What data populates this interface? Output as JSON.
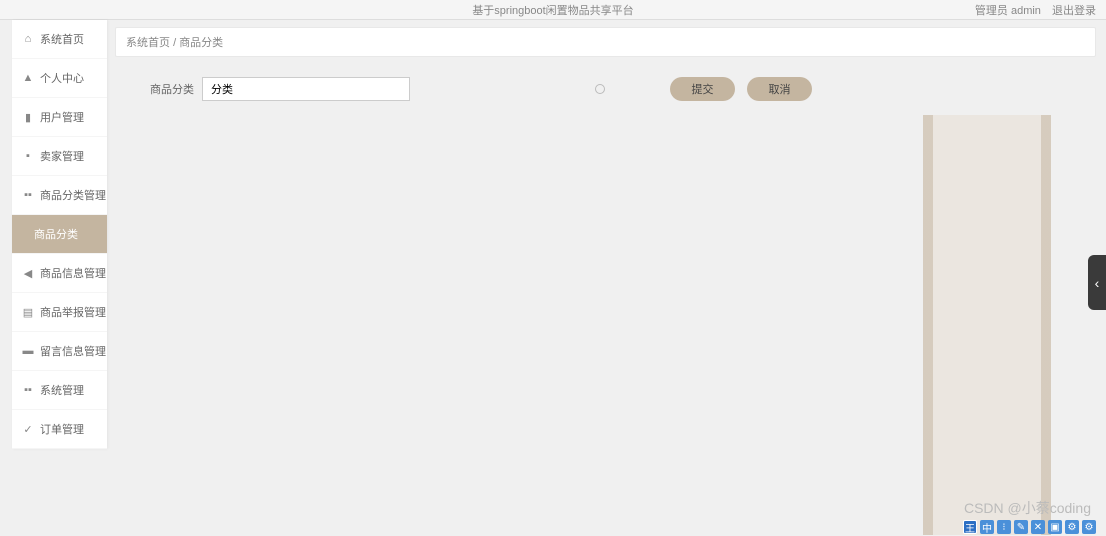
{
  "header": {
    "title": "基于springboot闲置物品共享平台",
    "admin_label": "管理员 admin",
    "logout_label": "退出登录"
  },
  "sidebar": {
    "items": [
      {
        "icon": "⌂",
        "label": "系统首页"
      },
      {
        "icon": "▲",
        "label": "个人中心"
      },
      {
        "icon": "▮",
        "label": "用户管理"
      },
      {
        "icon": "▪",
        "label": "卖家管理"
      },
      {
        "icon": "▪▪",
        "label": "商品分类管理"
      },
      {
        "icon": "",
        "label": "商品分类"
      },
      {
        "icon": "◀",
        "label": "商品信息管理"
      },
      {
        "icon": "▤",
        "label": "商品举报管理"
      },
      {
        "icon": "▬",
        "label": "留言信息管理"
      },
      {
        "icon": "▪▪",
        "label": "系统管理"
      },
      {
        "icon": "✓",
        "label": "订单管理"
      }
    ]
  },
  "breadcrumb": {
    "home": "系统首页",
    "separator": "/",
    "current": "商品分类"
  },
  "form": {
    "category_label": "商品分类",
    "category_value": "分类",
    "submit_label": "提交",
    "cancel_label": "取消"
  },
  "watermark": "CSDN @小蔡coding",
  "ime_bar": {
    "items": [
      "王",
      "中",
      "⁝",
      "✎",
      "✕",
      "▣",
      "⚙",
      "⚙"
    ]
  },
  "slide_tab_icon": "‹"
}
